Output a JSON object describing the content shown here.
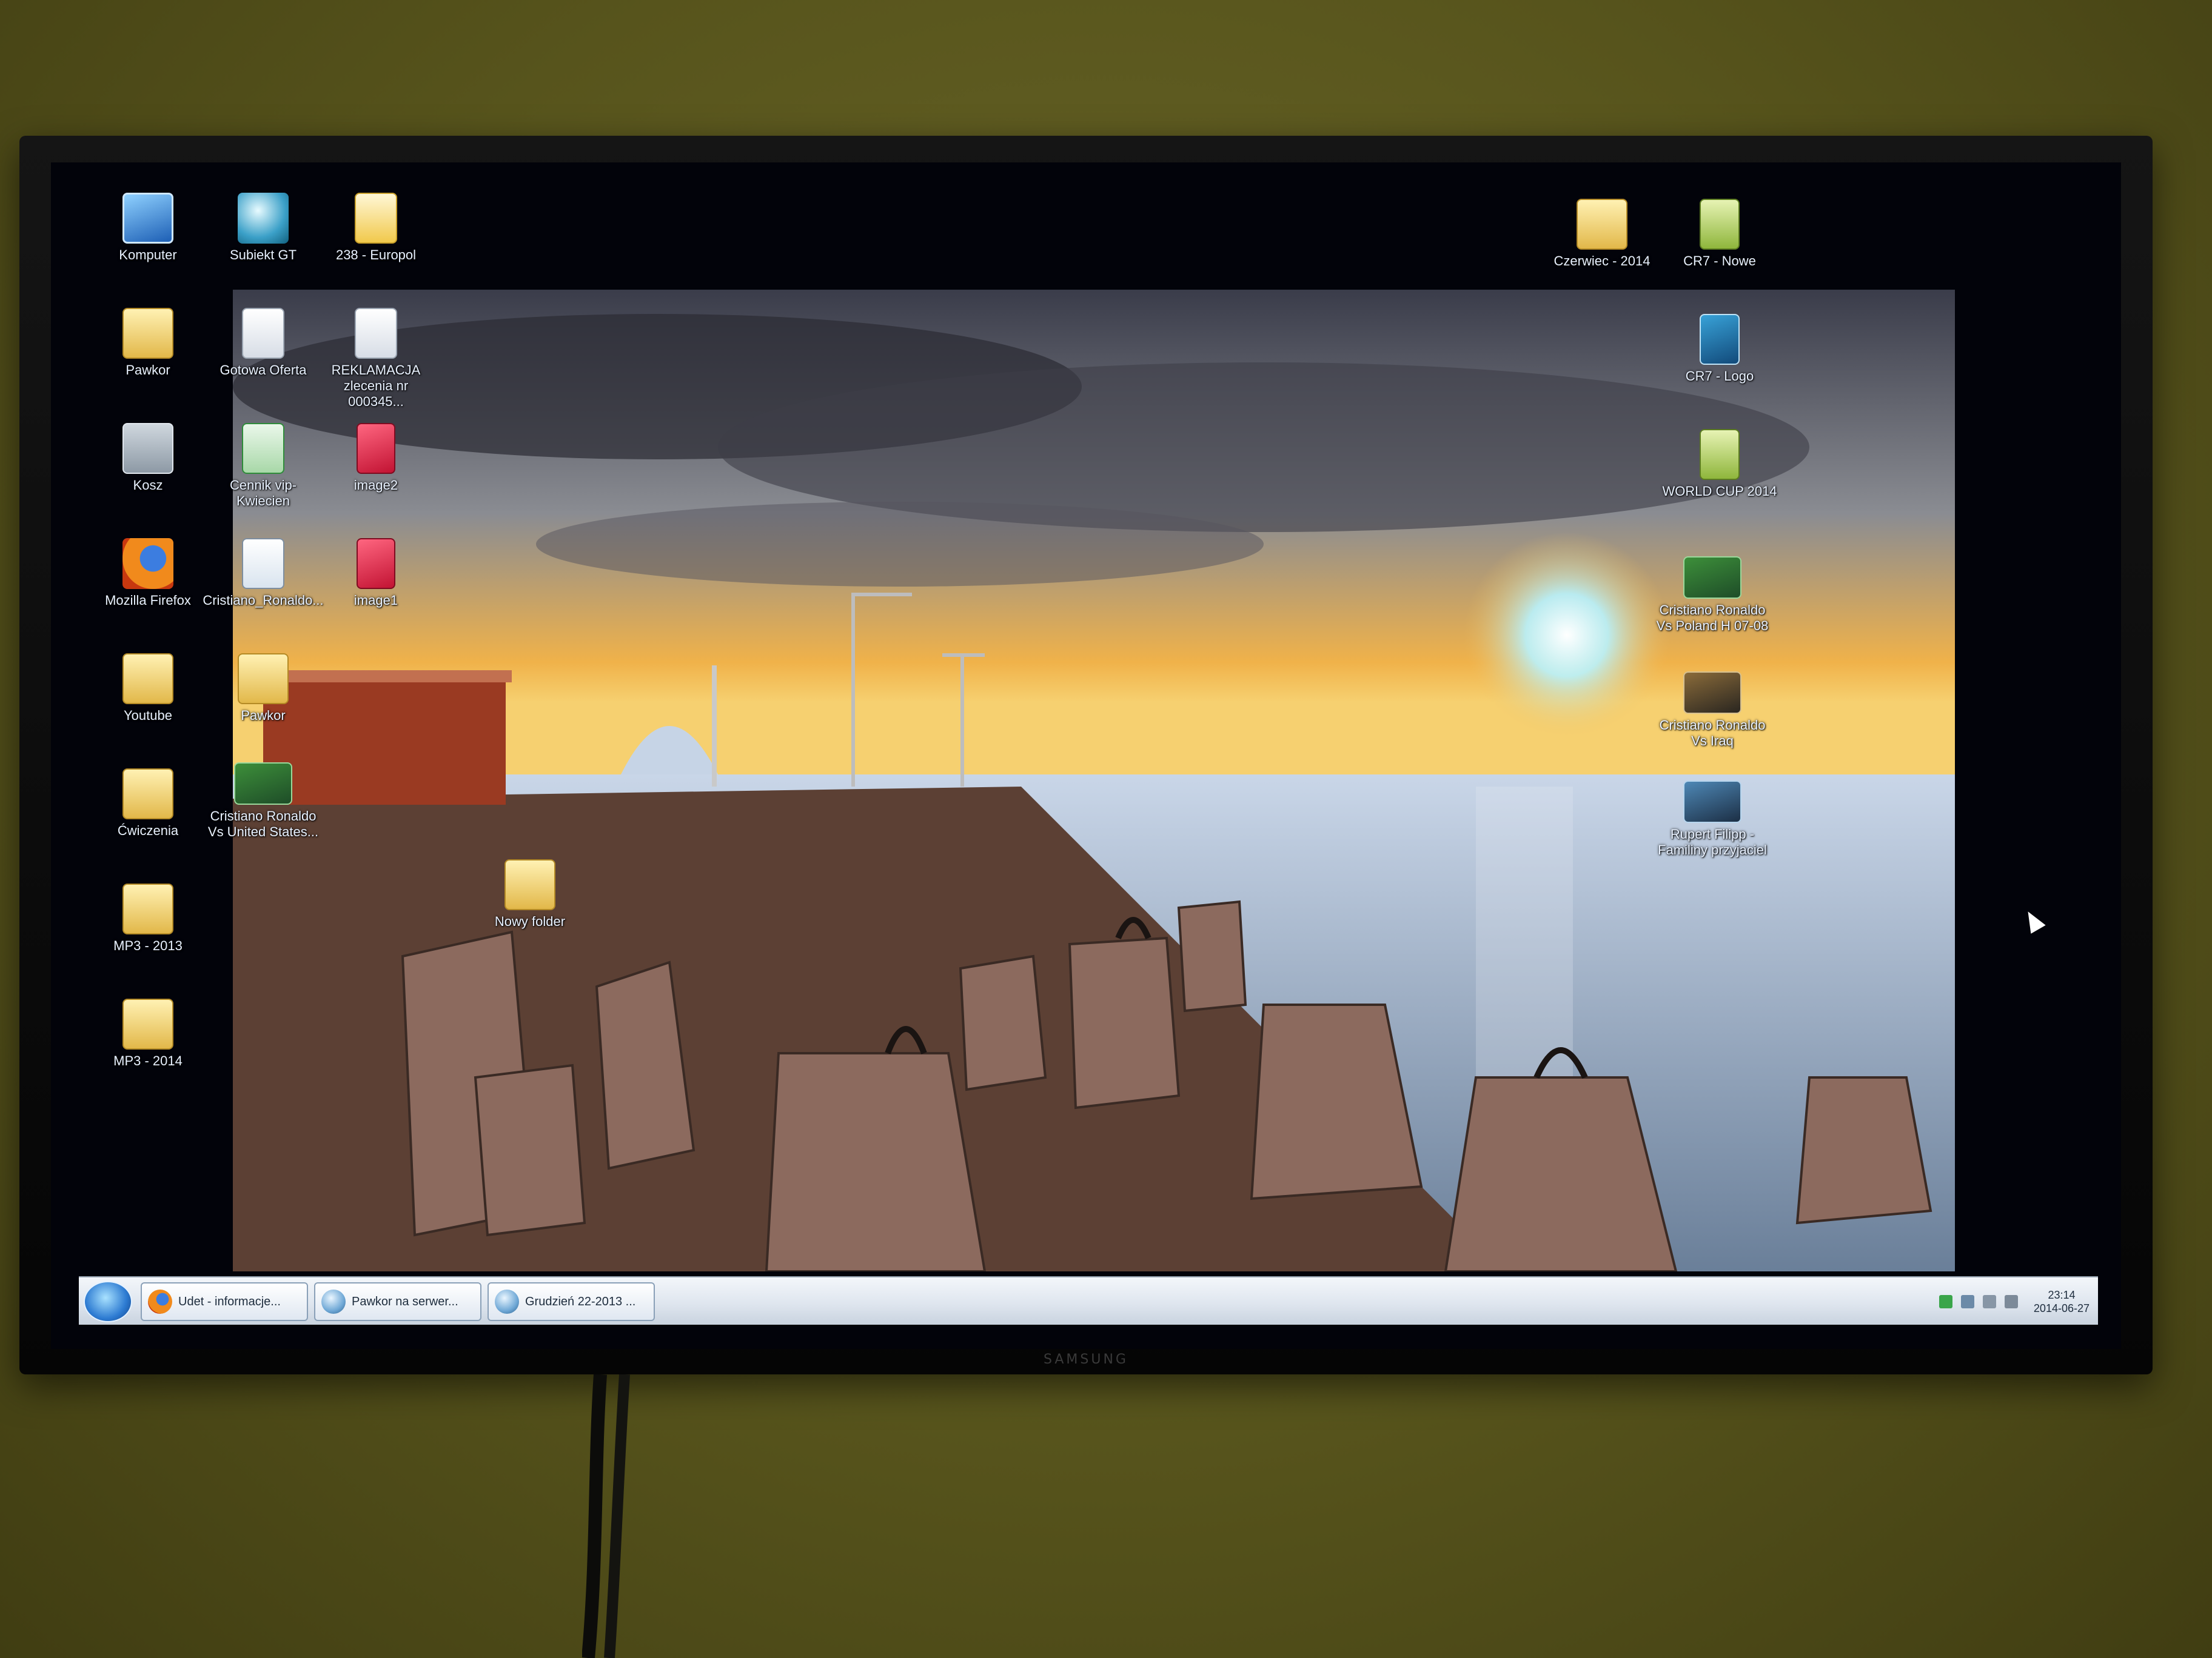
{
  "desktop": {
    "icons": [
      {
        "label": "Komputer"
      },
      {
        "label": "Subiekt GT"
      },
      {
        "label": "238 - Europol"
      },
      {
        "label": "Pawkor"
      },
      {
        "label": "Gotowa Oferta"
      },
      {
        "label": "REKLAMACJA\nzlecenia nr 000345..."
      },
      {
        "label": "Kosz"
      },
      {
        "label": "Cennik vip-\nKwiecien"
      },
      {
        "label": "image2"
      },
      {
        "label": "Mozilla Firefox"
      },
      {
        "label": "Cristiano_Ronaldo..."
      },
      {
        "label": "image1"
      },
      {
        "label": "Youtube"
      },
      {
        "label": "Pawkor"
      },
      {
        "label": "Ćwiczenia"
      },
      {
        "label": "Cristiano Ronaldo\nVs United States..."
      },
      {
        "label": "MP3 - 2013"
      },
      {
        "label": "MP3 - 2014"
      },
      {
        "label": "Nowy folder"
      },
      {
        "label": "Czerwiec - 2014"
      },
      {
        "label": "CR7 - Nowe"
      },
      {
        "label": "CR7 - Logo"
      },
      {
        "label": "WORLD CUP 2014"
      },
      {
        "label": "Cristiano Ronaldo\nVs Poland H 07-08"
      },
      {
        "label": "Cristiano Ronaldo\nVs Iraq"
      },
      {
        "label": "Rupert Filipp - \nFamiliny przyjaciel"
      }
    ]
  },
  "taskbar": {
    "tasks": [
      {
        "label": "Udet - informacje..."
      },
      {
        "label": "Pawkor na serwer..."
      },
      {
        "label": "Grudzień 22-2013 ..."
      }
    ],
    "clock_time": "23:14",
    "clock_date": "2014-06-27"
  },
  "tv": {
    "brand": "SAMSUNG"
  }
}
